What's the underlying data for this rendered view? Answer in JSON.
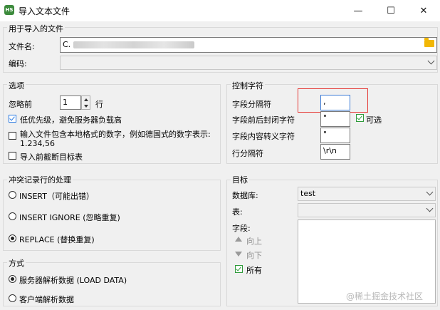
{
  "window": {
    "title": "导入文本文件",
    "minimize": "—",
    "maximize": "☐",
    "close": "✕"
  },
  "file_section": {
    "title": "用于导入的文件",
    "filename_label": "文件名:",
    "filename_value": "C.",
    "encoding_label": "编码:",
    "encoding_value": ""
  },
  "options": {
    "title": "选项",
    "ignore_label": "忽略前",
    "ignore_value": "1",
    "ignore_unit": "行",
    "low_priority": {
      "label": "低优先级，避免服务器负载高",
      "checked": true
    },
    "local_format": {
      "label_line1": "输入文件包含本地格式的数字，例如德国式的数字表示:",
      "label_line2": "1.234,56",
      "checked": false
    },
    "truncate": {
      "label": "导入前截断目标表",
      "checked": false
    }
  },
  "conflict": {
    "title": "冲突记录行的处理",
    "choices": [
      {
        "label": "INSERT（可能出错）",
        "selected": false
      },
      {
        "label": "INSERT IGNORE (忽略重复)",
        "selected": false
      },
      {
        "label": "REPLACE (替换重复)",
        "selected": true
      }
    ]
  },
  "method": {
    "title": "方式",
    "choices": [
      {
        "label": "服务器解析数据 (LOAD DATA)",
        "selected": true
      },
      {
        "label": "客户端解析数据",
        "selected": false
      }
    ]
  },
  "control_chars": {
    "title": "控制字符",
    "field_sep_label": "字段分隔符",
    "field_sep_value": ",",
    "enclosed_label": "字段前后封闭字符",
    "enclosed_value": "\"",
    "optional_label": "可选",
    "optional_checked": true,
    "escape_label": "字段内容转义字符",
    "escape_value": "\"",
    "line_sep_label": "行分隔符",
    "line_sep_value": "\\r\\n",
    "highlight_color": "#e53935"
  },
  "target": {
    "title": "目标",
    "database_label": "数据库:",
    "database_value": "test",
    "table_label": "表:",
    "table_value": "",
    "fields_label": "字段:",
    "up_label": "向上",
    "down_label": "向下",
    "all_label": "所有",
    "all_checked": true
  },
  "watermark": "@稀土掘金技术社区"
}
